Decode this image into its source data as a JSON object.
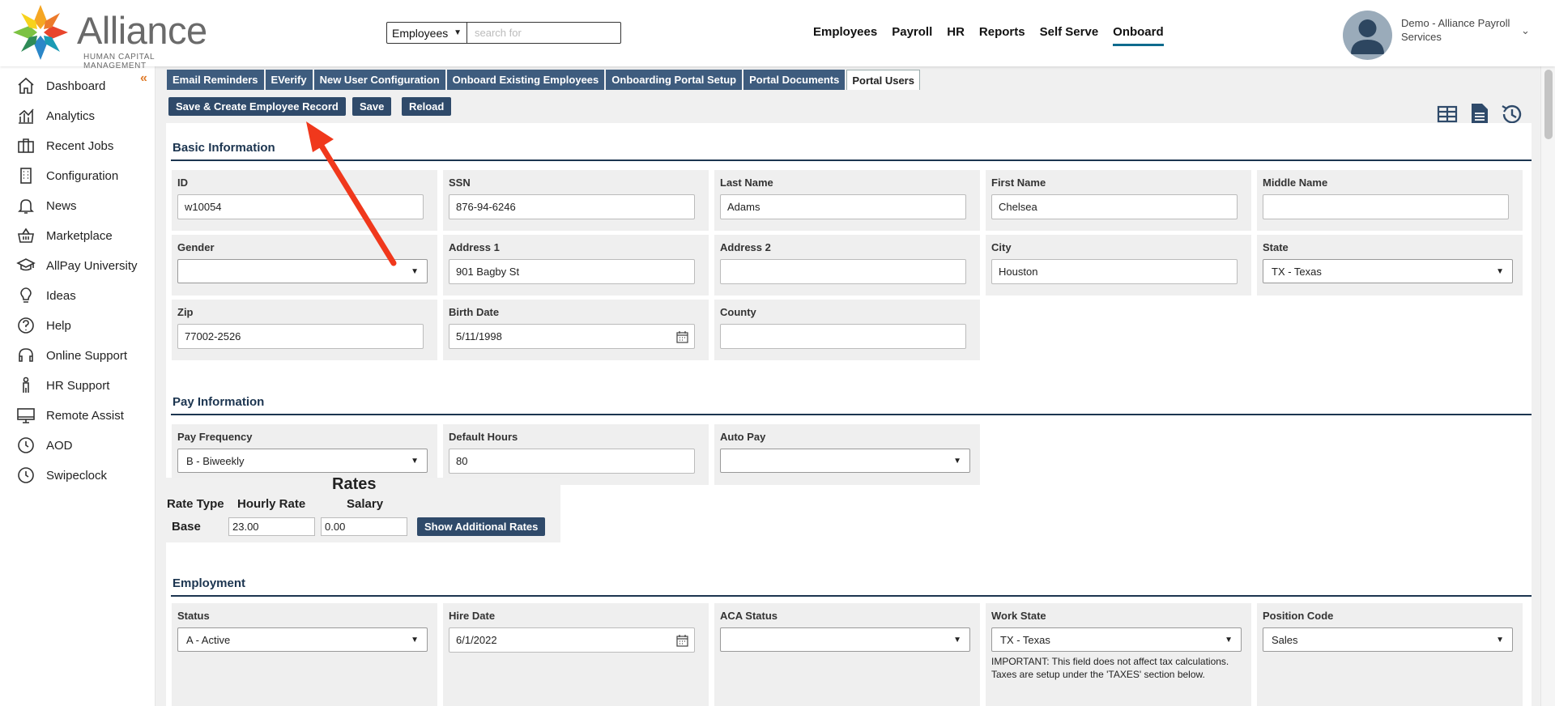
{
  "header": {
    "logo_text": "Alliance",
    "logo_subtitle": "HUMAN CAPITAL MANAGEMENT",
    "search_scope": "Employees",
    "search_placeholder": "search for",
    "nav": [
      "Employees",
      "Payroll",
      "HR",
      "Reports",
      "Self Serve",
      "Onboard"
    ],
    "nav_active": "Onboard",
    "user_name": "Demo - Alliance Payroll Services"
  },
  "sidebar": {
    "items": [
      {
        "label": "Dashboard",
        "icon": "home-icon"
      },
      {
        "label": "Analytics",
        "icon": "analytics-icon"
      },
      {
        "label": "Recent Jobs",
        "icon": "briefcase-icon"
      },
      {
        "label": "Configuration",
        "icon": "building-icon"
      },
      {
        "label": "News",
        "icon": "bell-icon"
      },
      {
        "label": "Marketplace",
        "icon": "basket-icon"
      },
      {
        "label": "AllPay University",
        "icon": "graduation-cap-icon"
      },
      {
        "label": "Ideas",
        "icon": "lightbulb-icon"
      },
      {
        "label": "Help",
        "icon": "question-icon"
      },
      {
        "label": "Online Support",
        "icon": "headset-icon"
      },
      {
        "label": "HR Support",
        "icon": "person-icon"
      },
      {
        "label": "Remote Assist",
        "icon": "monitor-icon"
      },
      {
        "label": "AOD",
        "icon": "clock-icon"
      },
      {
        "label": "Swipeclock",
        "icon": "clock-icon"
      }
    ]
  },
  "tabs": [
    "Email Reminders",
    "EVerify",
    "New User Configuration",
    "Onboard Existing Employees",
    "Onboarding Portal Setup",
    "Portal Documents",
    "Portal Users"
  ],
  "active_tab": "Portal Users",
  "buttons": {
    "save_create": "Save & Create Employee Record",
    "save": "Save",
    "reload": "Reload"
  },
  "basic": {
    "title": "Basic Information",
    "id": {
      "label": "ID",
      "value": "w10054"
    },
    "ssn": {
      "label": "SSN",
      "value": "876-94-6246"
    },
    "last_name": {
      "label": "Last Name",
      "value": "Adams"
    },
    "first_name": {
      "label": "First Name",
      "value": "Chelsea"
    },
    "middle_name": {
      "label": "Middle Name",
      "value": ""
    },
    "gender": {
      "label": "Gender",
      "value": ""
    },
    "address1": {
      "label": "Address 1",
      "value": "901 Bagby St"
    },
    "address2": {
      "label": "Address 2",
      "value": ""
    },
    "city": {
      "label": "City",
      "value": "Houston"
    },
    "state": {
      "label": "State",
      "value": "TX - Texas"
    },
    "zip": {
      "label": "Zip",
      "value": "77002-2526"
    },
    "birth_date": {
      "label": "Birth Date",
      "value": "5/11/1998"
    },
    "county": {
      "label": "County",
      "value": ""
    }
  },
  "pay": {
    "title": "Pay Information",
    "frequency": {
      "label": "Pay Frequency",
      "value": "B - Biweekly"
    },
    "default_hours": {
      "label": "Default Hours",
      "value": "80"
    },
    "auto_pay": {
      "label": "Auto Pay",
      "value": ""
    }
  },
  "rates": {
    "title": "Rates",
    "col_rate_type": "Rate Type",
    "col_hourly": "Hourly Rate",
    "col_salary": "Salary",
    "row_label": "Base",
    "hourly": "23.00",
    "salary": "0.00",
    "more_button": "Show Additional Rates"
  },
  "employment": {
    "title": "Employment",
    "status": {
      "label": "Status",
      "value": "A - Active"
    },
    "hire_date": {
      "label": "Hire Date",
      "value": "6/1/2022"
    },
    "aca_status": {
      "label": "ACA Status",
      "value": ""
    },
    "work_state": {
      "label": "Work State",
      "value": "TX - Texas",
      "note": "IMPORTANT: This field does not affect tax calculations. Taxes are setup under the 'TAXES' section below."
    },
    "position_code": {
      "label": "Position Code",
      "value": "Sales"
    }
  },
  "colors": {
    "accent": "#3e5c7e",
    "button": "#2f4a6a",
    "section_title": "#1c3550",
    "arrow": "#f0381c"
  }
}
